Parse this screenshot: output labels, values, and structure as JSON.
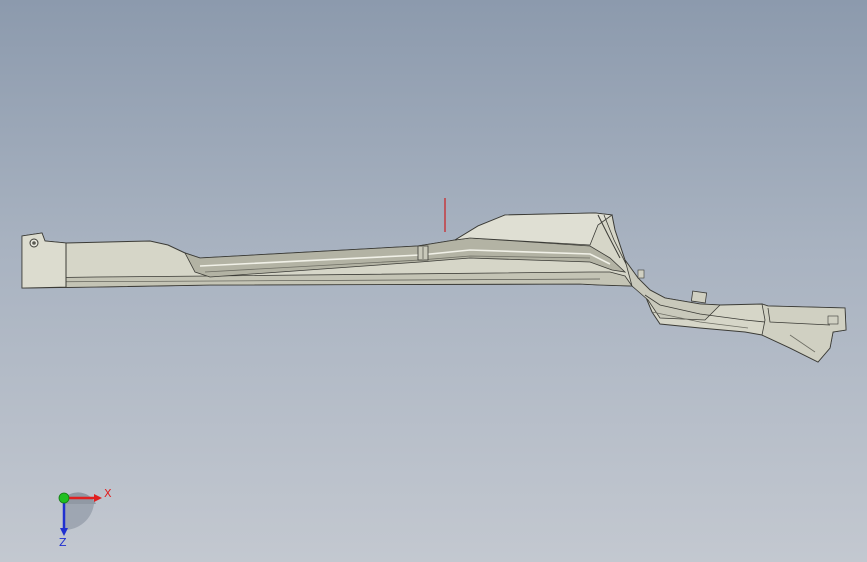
{
  "viewport": {
    "background_top": "#8c9aad",
    "background_bottom": "#c3c8d0"
  },
  "model": {
    "surface_color": "#d6d6c8",
    "edge_color": "#3b3b36",
    "shadow_color": "#8e8e80",
    "highlight_color": "#f1f1e8",
    "marker_color": "#d40000"
  },
  "triad": {
    "x_label": "X",
    "z_label": "Z",
    "x_color": "#e02020",
    "y_color": "#20c020",
    "z_color": "#2030d0"
  }
}
